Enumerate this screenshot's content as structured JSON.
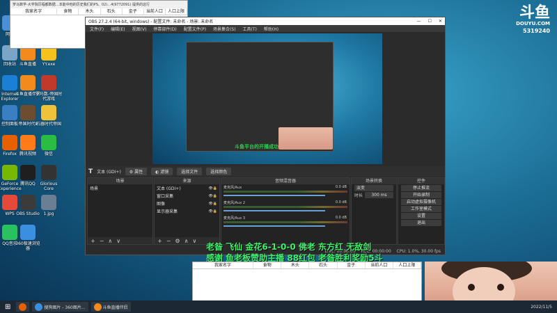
{
  "top_table": {
    "title": "罗马数学-大学院历程都数据…本能中他的历史我们的PS、02)...4(9772091) 提供的这行",
    "columns": [
      "我家名字",
      "食物",
      "木头",
      "石头",
      "金子",
      "当前人口",
      "人口上限"
    ]
  },
  "desktop_icons": [
    {
      "label": "网络",
      "color": "#4a90d9"
    },
    {
      "label": "电脑管家",
      "color": "#2d7fd3"
    },
    {
      "label": "电脑管家组件",
      "color": "#e04b3b"
    },
    {
      "label": "回收站",
      "color": "#7aa5c8"
    },
    {
      "label": "斗鱼直播",
      "color": "#f28a1d"
    },
    {
      "label": "YY.exe",
      "color": "#f4c21a"
    },
    {
      "label": "Internet Explorer",
      "color": "#1c7fd6"
    },
    {
      "label": "斗鱼直播伴侣",
      "color": "#f28a1d"
    },
    {
      "label": "罗马数-帝国时代游戏",
      "color": "#c0392b"
    },
    {
      "label": "控制面板",
      "color": "#3a7ec4"
    },
    {
      "label": "帝国时代Ⅱ",
      "color": "#6d4c2f"
    },
    {
      "label": "石器时代帝国",
      "color": "#f0c23a"
    },
    {
      "label": "Firefox",
      "color": "#e66000"
    },
    {
      "label": "腾讯视频",
      "color": "#ff7a18"
    },
    {
      "label": "微信",
      "color": "#2bbd43"
    },
    {
      "label": "GeForce Experience",
      "color": "#76b900"
    },
    {
      "label": "腾讯QQ",
      "color": "#1f1f1f"
    },
    {
      "label": "Glorious Core",
      "color": "#333333"
    },
    {
      "label": "WPS",
      "color": "#e5493a"
    },
    {
      "label": "OBS Studio",
      "color": "#3b3b3b"
    },
    {
      "label": "1.jpg",
      "color": "#6b7f93"
    },
    {
      "label": "QQ音乐",
      "color": "#28c35f"
    },
    {
      "label": "360极速浏览器",
      "color": "#3b8fe0"
    }
  ],
  "obs": {
    "title": "OBS 27.2.4 (64-bit, windows) - 配置文件: 未命名 - 场景: 未命名",
    "menu": [
      "文件(F)",
      "编辑(E)",
      "视图(V)",
      "停靠部件(D)",
      "配置文件(P)",
      "场景集合(S)",
      "工具(T)",
      "帮助(H)"
    ],
    "preview_overlay": "斗鱼平台的开播成功",
    "source_bar": {
      "label": "文本 (GDI+)",
      "btn_props": "属性",
      "btn_filters": "滤镜",
      "btn_select_file": "选择文件",
      "btn_select_color": "选择颜色"
    },
    "docks": {
      "scenes": {
        "header": "场景",
        "items": [
          "场景"
        ]
      },
      "sources": {
        "header": "来源",
        "items": [
          "文本 (GDI+)",
          "窗口采集",
          "图像",
          "显示器采集"
        ]
      },
      "mixer": {
        "header": "音频混音器",
        "tracks": [
          {
            "name": "麦克风/Aux",
            "db": "0.0 dB"
          },
          {
            "name": "麦克风/Aux 2",
            "db": "0.0 dB"
          },
          {
            "name": "麦克风/Aux 3",
            "db": "0.0 dB"
          }
        ]
      },
      "transitions": {
        "header": "场景转换",
        "type": "淡变",
        "duration_label": "时长",
        "duration": "300 ms"
      },
      "controls": {
        "header": "控件",
        "buttons": [
          "停止推流",
          "开始录制",
          "启动虚拟摄像机",
          "工作室模式",
          "设置",
          "退出"
        ]
      }
    },
    "status": [
      "LIVE: 00:00:00",
      "REC: 00:00:00",
      "CPU: 1.0%, 30.00 fps"
    ]
  },
  "danmu": {
    "line1": "老昝 飞仙 金花6-1-0-0 佛老 东方红 无敌剑",
    "line2": "感谢 鱼老板赞助主播 88红包 老昝胜利奖励5斗"
  },
  "bottom_table": {
    "columns": [
      "我家名字",
      "食物",
      "木头",
      "石头",
      "金子",
      "当前人口",
      "人口上限"
    ]
  },
  "douyu": {
    "logo": "斗鱼",
    "sub": "DOUYU.COM",
    "room_id": "5319240"
  },
  "taskbar": {
    "apps": [
      "",
      "",
      "搜狗图片 - 360图片...",
      "斗鱼直播伴侣"
    ],
    "clock": "2022/11/5"
  }
}
